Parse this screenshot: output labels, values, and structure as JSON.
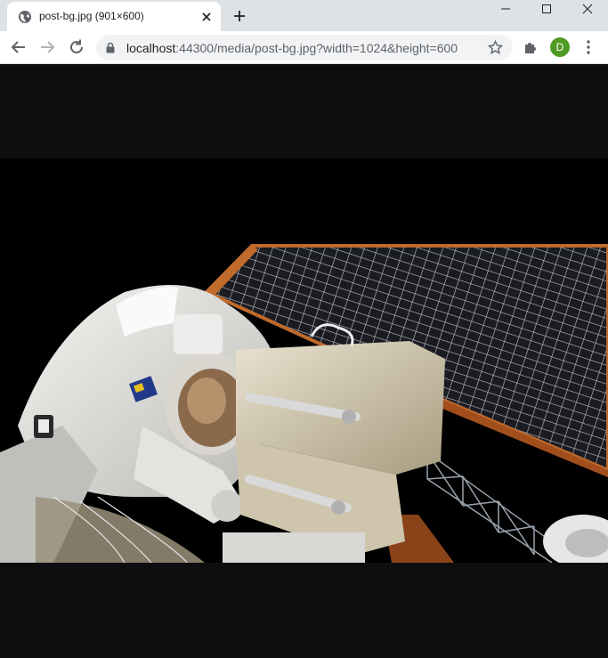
{
  "tab": {
    "title": "post-bg.jpg (901×600)",
    "favicon": "globe-icon"
  },
  "omnibox": {
    "url_host": "localhost",
    "url_rest": ":44300/media/post-bg.jpg?width=1024&height=600"
  },
  "profile": {
    "initial": "D",
    "color": "#4f9a24"
  },
  "image": {
    "alt": "astronaut-spacewalk-photo"
  },
  "colors": {
    "background": "#0e0e0e",
    "titlebar": "#dee1e6"
  }
}
